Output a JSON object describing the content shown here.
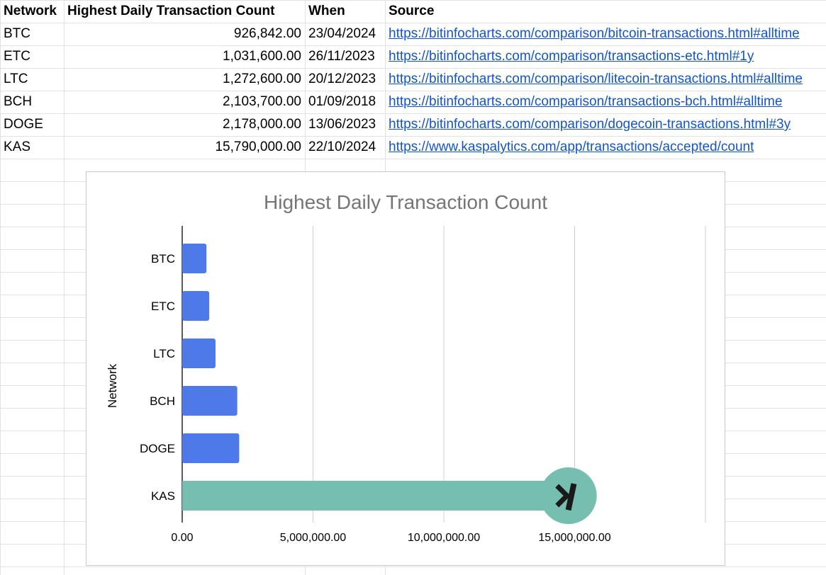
{
  "sheet": {
    "headers": [
      "Network",
      "Highest Daily Transaction Count",
      "When",
      "Source"
    ],
    "rows": [
      [
        "BTC",
        "926,842.00",
        "23/04/2024",
        "https://bitinfocharts.com/comparison/bitcoin-transactions.html#alltime"
      ],
      [
        "ETC",
        "1,031,600.00",
        "26/11/2023",
        "https://bitinfocharts.com/comparison/transactions-etc.html#1y"
      ],
      [
        "LTC",
        "1,272,600.00",
        "20/12/2023",
        "https://bitinfocharts.com/comparison/litecoin-transactions.html#alltime"
      ],
      [
        "BCH",
        "2,103,700.00",
        "01/09/2018",
        "https://bitinfocharts.com/comparison/transactions-bch.html#alltime"
      ],
      [
        "DOGE",
        "2,178,000.00",
        "13/06/2023",
        "https://bitinfocharts.com/comparison/dogecoin-transactions.html#3y"
      ],
      [
        "KAS",
        "15,790,000.00",
        "22/10/2024",
        "https://www.kaspalytics.com/app/transactions/accepted/count"
      ]
    ]
  },
  "chart_data": {
    "type": "bar",
    "orientation": "horizontal",
    "title": "Highest Daily Transaction Count",
    "ylabel": "Network",
    "xlabel": "",
    "categories": [
      "BTC",
      "ETC",
      "LTC",
      "BCH",
      "DOGE",
      "KAS"
    ],
    "values": [
      926842,
      1031600,
      1272600,
      2103700,
      2178000,
      15790000
    ],
    "xlim": [
      0,
      20000000
    ],
    "xticks": [
      0,
      5000000,
      10000000,
      15000000
    ],
    "xtick_labels": [
      "0.00",
      "5,000,000.00",
      "10,000,000.00",
      "15,000,000.00"
    ],
    "grid": true,
    "colors": {
      "default": "#4e79e8",
      "highlight": "#76bfb0",
      "title": "#757575",
      "logo": "#1a1a1a"
    },
    "highlight_category": "KAS",
    "highlight_icon": "kaspa-logo-icon"
  }
}
